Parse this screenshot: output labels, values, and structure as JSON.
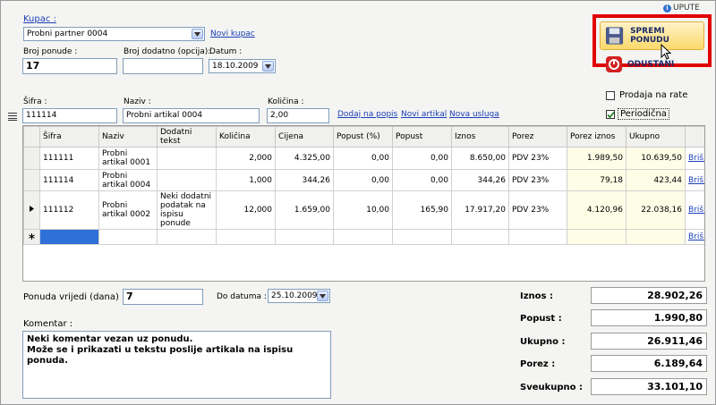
{
  "header": {
    "upute_label": "UPUTE"
  },
  "customer": {
    "label": "Kupac :",
    "value": "Probni partner 0004",
    "new_link": "Novi kupac"
  },
  "offer": {
    "number_label": "Broj ponude :",
    "number_value": "17",
    "extra_label": "Broj dodatno (opcija):",
    "extra_value": "",
    "date_label": "Datum :",
    "date_value": "18.10.2009"
  },
  "actions": {
    "save_label": "SPREMI PONUDU",
    "cancel_label": "ODUSTANI"
  },
  "options": {
    "installments_label": "Prodaja na rate",
    "installments_checked": false,
    "periodic_label": "Periodična",
    "periodic_checked": true
  },
  "entry": {
    "sifra_label": "Šifra :",
    "sifra_value": "111114",
    "naziv_label": "Naziv :",
    "naziv_value": "Probni artikal 0004",
    "kolicina_label": "Količina :",
    "kolicina_value": "2,00",
    "add_link": "Dodaj na popis",
    "new_article_link": "Novi artikal",
    "new_service_link": "Nova usluga"
  },
  "table": {
    "headers": [
      "Šifra",
      "Naziv",
      "Dodatni tekst",
      "Količina",
      "Cijena",
      "Popust (%)",
      "Popust",
      "Iznos",
      "Porez",
      "Porez iznos",
      "Ukupno",
      ""
    ],
    "rows": [
      [
        "111111",
        "Probni artikal 0001",
        "",
        "2,000",
        "4.325,00",
        "0,00",
        "0,00",
        "8.650,00",
        "PDV 23%",
        "1.989,50",
        "10.639,50",
        "Briši"
      ],
      [
        "111114",
        "Probni artikal 0004",
        "",
        "1,000",
        "344,26",
        "0,00",
        "0,00",
        "344,26",
        "PDV 23%",
        "79,18",
        "423,44",
        "Briši"
      ],
      [
        "111112",
        "Probni artikal 0002",
        "Neki dodatni podatak na ispisu ponude",
        "12,000",
        "1.659,00",
        "10,00",
        "165,90",
        "17.917,20",
        "PDV 23%",
        "4.120,96",
        "22.038,16",
        "Briši"
      ]
    ],
    "new_row_delete": "Briši"
  },
  "validity": {
    "days_label": "Ponuda vrijedi (dana) :",
    "days_value": "7",
    "until_label": "Do datuma :",
    "until_value": "25.10.2009"
  },
  "comment": {
    "label": "Komentar :",
    "line1": "Neki komentar vezan uz ponudu.",
    "line2": "Može se i prikazati u tekstu poslije artikala na ispisu ponuda."
  },
  "totals": {
    "iznos_label": "Iznos :",
    "iznos_value": "28.902,26",
    "popust_label": "Popust :",
    "popust_value": "1.990,80",
    "ukupno_label": "Ukupno :",
    "ukupno_value": "26.911,46",
    "porez_label": "Porez :",
    "porez_value": "6.189,64",
    "sveukupno_label": "Sveukupno :",
    "sveukupno_value": "33.101,10"
  },
  "colors": {
    "highlight_frame": "#e00000",
    "save_button": "#fbd96b",
    "cancel_icon": "#d42020",
    "link": "#1a3fb8",
    "input_border": "#7f9db9"
  }
}
